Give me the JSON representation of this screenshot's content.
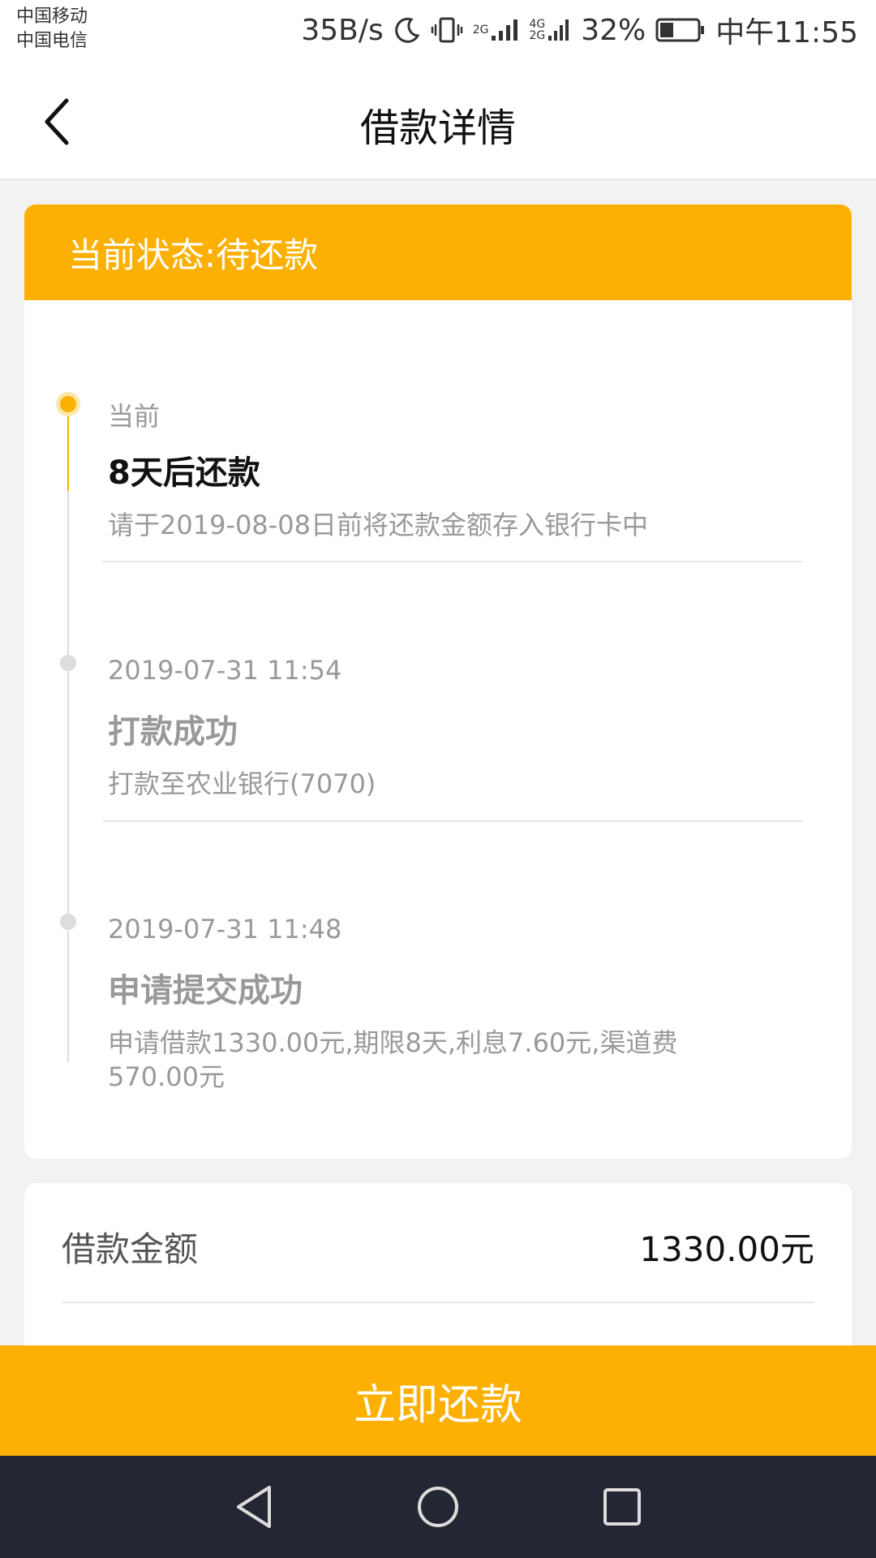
{
  "status_bar": {
    "carrier_1": "中国移动",
    "carrier_2": "中国电信",
    "net_speed": "35B/s",
    "network_1": "2G",
    "network_2_top": "4G",
    "network_2_bottom": "2G",
    "battery": "32%",
    "time": "中午11:55",
    "icons": [
      "moon-icon",
      "vibrate-icon",
      "signal-icon",
      "battery-icon"
    ]
  },
  "nav": {
    "title": "借款详情",
    "back_icon": "back-arrow-icon"
  },
  "status_card": {
    "header": "当前状态:待还款",
    "timeline": [
      {
        "meta": "当前",
        "title": "8天后还款",
        "desc": "请于2019-08-08日前将还款金额存入银行卡中",
        "active": true
      },
      {
        "meta": "2019-07-31 11:54",
        "title": "打款成功",
        "desc": "打款至农业银行(7070)",
        "active": false
      },
      {
        "meta": "2019-07-31 11:48",
        "title": "申请提交成功",
        "desc": "申请借款1330.00元,期限8天,利息7.60元,渠道费570.00元",
        "active": false
      }
    ]
  },
  "summary": {
    "label": "借款金额",
    "value": "1330.00元"
  },
  "action": {
    "repay_label": "立即还款"
  },
  "colors": {
    "accent": "#fcb003",
    "nav_bg": "#242733"
  }
}
